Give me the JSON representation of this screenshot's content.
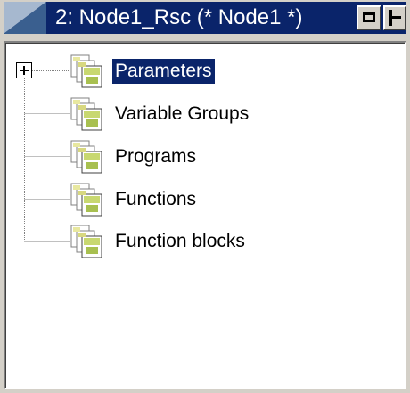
{
  "window": {
    "title": "2: Node1_Rsc (* Node1 *)",
    "colors": {
      "titlebar": "#0a246a",
      "selection": "#0a246a",
      "face": "#d4d0c8"
    },
    "buttons": [
      {
        "name": "restore-button",
        "icon": "restore-icon"
      },
      {
        "name": "dock-button",
        "icon": "dock-icon"
      }
    ]
  },
  "tree": {
    "root_expander": "+",
    "items": [
      {
        "label": "Parameters",
        "icon": "folder-pages-icon",
        "selected": true,
        "expandable": true
      },
      {
        "label": "Variable Groups",
        "icon": "folder-pages-icon",
        "selected": false
      },
      {
        "label": "Programs",
        "icon": "folder-pages-icon",
        "selected": false
      },
      {
        "label": "Functions",
        "icon": "folder-pages-icon",
        "selected": false
      },
      {
        "label": "Function blocks",
        "icon": "folder-pages-icon",
        "selected": false
      }
    ]
  }
}
